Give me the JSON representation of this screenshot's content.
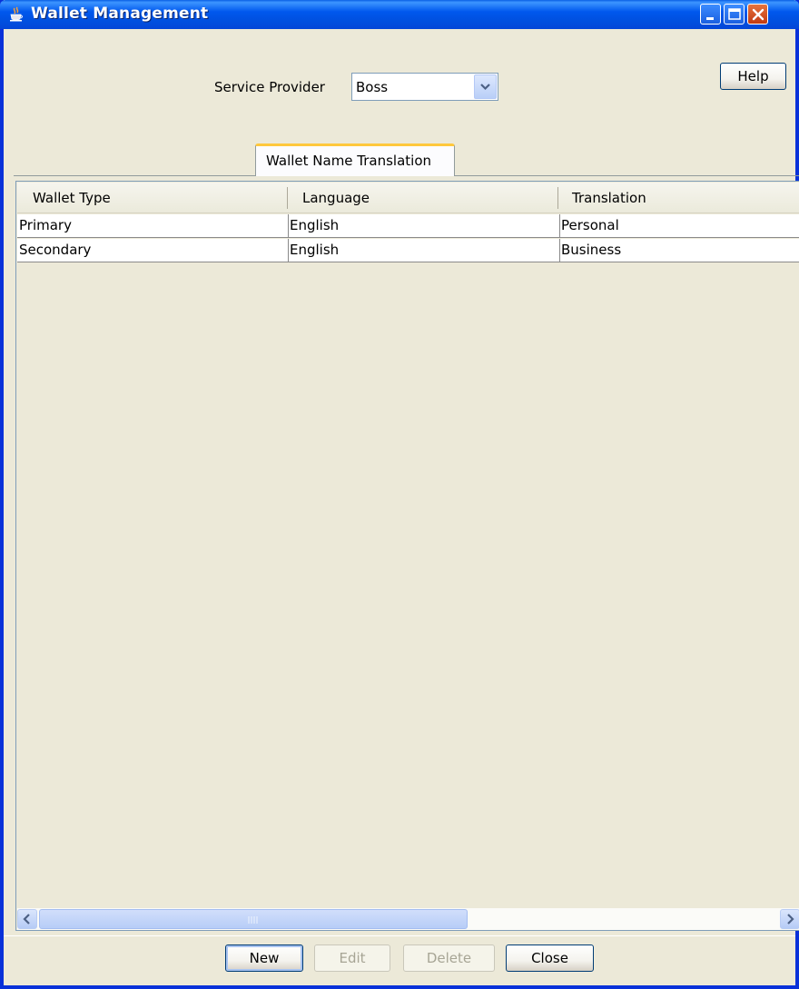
{
  "window": {
    "title": "Wallet Management"
  },
  "form": {
    "service_provider_label": "Service Provider",
    "service_provider_value": "Boss",
    "help_label": "Help"
  },
  "tabs": [
    {
      "label": "Wallet Name Translation",
      "selected": true
    }
  ],
  "table": {
    "columns": [
      "Wallet Type",
      "Language",
      "Translation"
    ],
    "rows": [
      [
        "Primary",
        "English",
        "Personal"
      ],
      [
        "Secondary",
        "English",
        "Business"
      ]
    ]
  },
  "footer": {
    "new_label": "New",
    "edit_label": "Edit",
    "delete_label": "Delete",
    "close_label": "Close"
  },
  "colors": {
    "titlebar": "#0058ee",
    "window_bg": "#ece9d8",
    "tab_accent": "#ffc83c"
  }
}
